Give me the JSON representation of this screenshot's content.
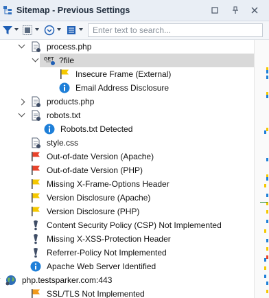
{
  "window": {
    "title": "Sitemap - Previous Settings",
    "controls": [
      "restore",
      "pin",
      "close"
    ]
  },
  "toolbar": {
    "search_placeholder": "Enter text to search...",
    "tools": [
      "filter-icon",
      "layout-icon",
      "refresh-icon",
      "view-icon"
    ]
  },
  "tree": [
    {
      "label": "process.php",
      "icon": "file-icon",
      "toggle": "open",
      "indent": 0
    },
    {
      "label": "?file",
      "icon": "get-request-icon",
      "toggle": "open",
      "indent": 1,
      "selected": true
    },
    {
      "label": "Insecure Frame (External)",
      "icon": "yellow-flag-icon",
      "indent": 2
    },
    {
      "label": "Email Address Disclosure",
      "icon": "info-icon",
      "indent": 2
    },
    {
      "label": "products.php",
      "icon": "file-icon",
      "toggle": "closed",
      "indent": 0
    },
    {
      "label": "robots.txt",
      "icon": "file-icon",
      "toggle": "open",
      "indent": 0
    },
    {
      "label": "Robots.txt Detected",
      "icon": "info-icon",
      "indent": 1
    },
    {
      "label": "style.css",
      "icon": "file-icon",
      "indent": 0
    },
    {
      "label": "Out-of-date Version (Apache)",
      "icon": "red-flag-icon",
      "indent": 0
    },
    {
      "label": "Out-of-date Version (PHP)",
      "icon": "red-flag-icon",
      "indent": 0
    },
    {
      "label": "Missing X-Frame-Options Header",
      "icon": "yellow-flag-icon",
      "indent": 0
    },
    {
      "label": "Version Disclosure (Apache)",
      "icon": "yellow-flag-icon",
      "indent": 0
    },
    {
      "label": "Version Disclosure (PHP)",
      "icon": "yellow-flag-icon",
      "indent": 0
    },
    {
      "label": "Content Security Policy (CSP) Not Implemented",
      "icon": "exclamation-icon",
      "indent": 0
    },
    {
      "label": "Missing X-XSS-Protection Header",
      "icon": "exclamation-icon",
      "indent": 0
    },
    {
      "label": "Referrer-Policy Not Implemented",
      "icon": "exclamation-icon",
      "indent": 0
    },
    {
      "label": "Apache Web Server Identified",
      "icon": "info-icon",
      "indent": 0
    },
    {
      "label": "php.testsparker.com:443",
      "icon": "globe-icon",
      "toggle": "open",
      "indent": -1
    },
    {
      "label": "SSL/TLS Not Implemented",
      "icon": "orange-flag-icon",
      "indent": 0
    }
  ],
  "colors": {
    "info": "#1e7fd8",
    "red": "#e8432b",
    "yellow": "#f5c800",
    "orange": "#f29a1c",
    "exclamation": "#3f4d66",
    "selection": "#d9d9d9"
  }
}
